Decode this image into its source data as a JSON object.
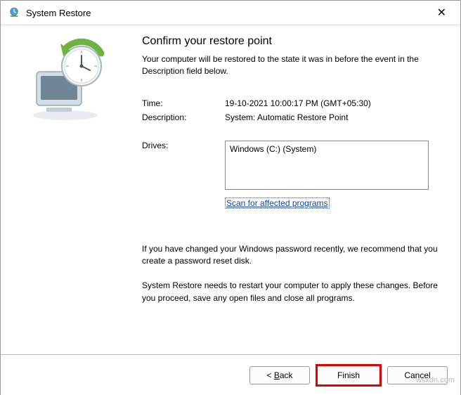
{
  "window": {
    "title": "System Restore"
  },
  "main": {
    "heading": "Confirm your restore point",
    "subtext": "Your computer will be restored to the state it was in before the event in the Description field below.",
    "time_label": "Time:",
    "time_value": "19-10-2021 10:00:17 PM (GMT+05:30)",
    "description_label": "Description:",
    "description_value": "System: Automatic Restore Point",
    "drives_label": "Drives:",
    "drives_value": "Windows (C:) (System)",
    "scan_link": "Scan for affected programs",
    "note1": "If you have changed your Windows password recently, we recommend that you create a password reset disk.",
    "note2": "System Restore needs to restart your computer to apply these changes. Before you proceed, save any open files and close all programs."
  },
  "buttons": {
    "back": "Back",
    "finish": "Finish",
    "cancel": "Cancel"
  },
  "watermark": "wsxdn.com"
}
